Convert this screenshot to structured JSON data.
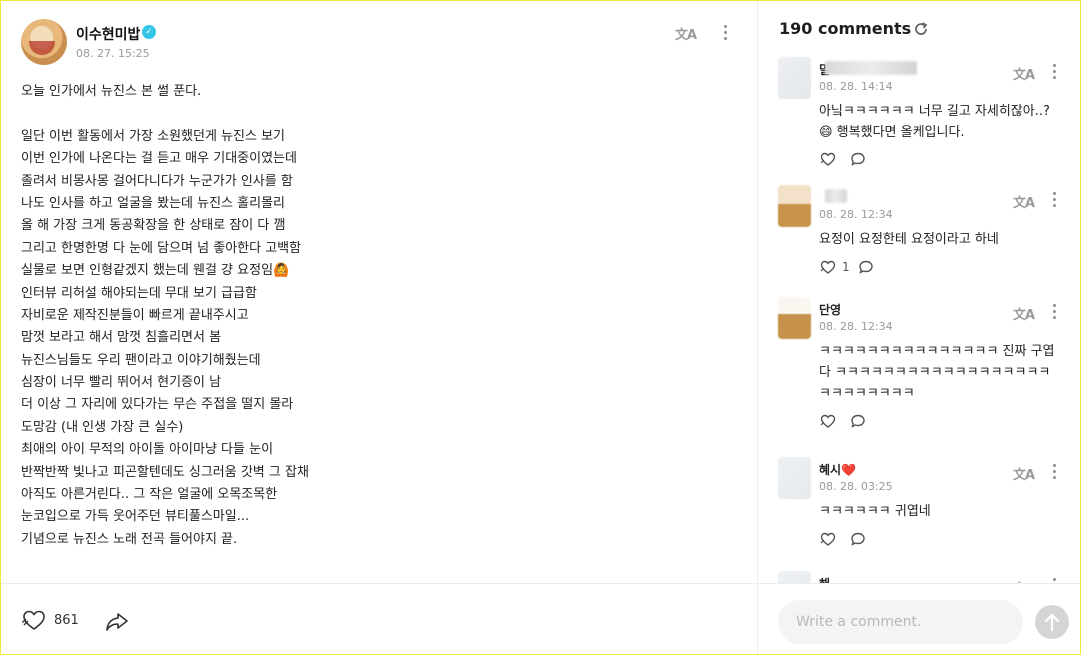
{
  "post": {
    "author_name": "이수현미밥",
    "date": "08. 27. 15:25",
    "body_lines": [
      "오늘 인가에서 뉴진스 본 썰 푼다.",
      "",
      "일단 이번 활동에서 가장 소원했던게 뉴진스 보기",
      "이번 인가에 나온다는 걸 듣고 매우 기대중이였는데",
      "졸려서 비몽사몽 걸어다니다가 누군가가 인사를 함",
      "나도 인사를 하고 얼굴을 봤는데 뉴진스 홀리몰리",
      "올 해 가장 크게 동공확장을 한 상태로 잠이 다 깸",
      "그리고 한명한명 다 눈에 담으며 넘 좋아한다 고백함",
      "실물로 보면 인형같겠지 했는데 웬걸 걍 요정임🙆",
      "인터뷰 리허설 해야되는데 무대 보기 급급함",
      "자비로운 제작진분들이 빠르게 끝내주시고",
      "맘껏 보라고 해서 맘껏 침흘리면서 봄",
      "뉴진스님들도 우리 팬이라고 이야기해줬는데",
      "심장이 너무 빨리 뛰어서 현기증이 남",
      "더 이상 그 자리에 있다가는 무슨 주접을 떨지 몰라",
      "도망감 (내 인생 가장 큰 실수)",
      "최애의 아이 무적의 아이돌 아이마냥 다들 눈이",
      "반짝반짝 빛나고 피곤할텐데도 싱그러움 갓벽 그 잡채",
      "아직도 아른거린다.. 그 작은 얼굴에 오목조목한",
      "눈코입으로 가득 웃어주던 뷰티풀스마일...",
      "기념으로 뉴진스 노래 전곡 들어야지 끝."
    ],
    "like_count": "861",
    "translate_icon": "文A",
    "icons": {
      "verified": "verified-badge-icon",
      "like": "heart-icon",
      "share": "share-icon",
      "more": "more-vertical-icon"
    }
  },
  "comments_panel": {
    "header": "190 comments",
    "refresh_icon": "refresh-icon",
    "input_placeholder": "Write a comment.",
    "send_icon": "arrow-up-icon",
    "items": [
      {
        "name": "밀",
        "date": "08. 28. 14:14",
        "text": "아닠ㅋㅋㅋㅋㅋㅋ 너무 길고 자세히잖아..? 😄 행복했다면 올케입니다.",
        "like_count": ""
      },
      {
        "name": "",
        "date": "08. 28. 12:34",
        "text": "요정이 요정한테 요정이라고 하네",
        "like_count": "1"
      },
      {
        "name": "단영",
        "date": "08. 28. 12:34",
        "text": "ㅋㅋㅋㅋㅋㅋㅋㅋㅋㅋㅋㅋㅋㅋㅋ 진짜 구엽다 ㅋㅋㅋㅋㅋㅋㅋㅋㅋㅋㅋㅋㅋㅋㅋㅋㅋㅋㅋㅋㅋㅋㅋㅋㅋㅋ",
        "like_count": ""
      },
      {
        "name": "혜시❤️",
        "date": "08. 28. 03:25",
        "text": "ㅋㅋㅋㅋㅋㅋ 귀엽네",
        "like_count": ""
      },
      {
        "name": "해",
        "date": "",
        "text": "",
        "like_count": ""
      }
    ]
  }
}
